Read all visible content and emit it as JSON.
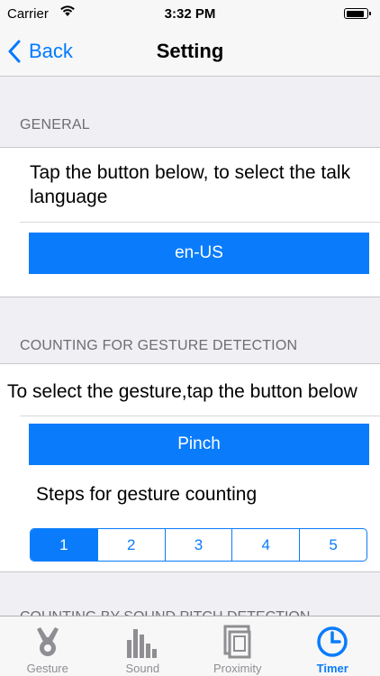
{
  "status_bar": {
    "carrier": "Carrier",
    "time": "3:32 PM"
  },
  "nav": {
    "back_label": "Back",
    "title": "Setting"
  },
  "general": {
    "header": "GENERAL",
    "description": "Tap the button below, to select the talk language",
    "description_line1": "Tap the button below, to select the talk",
    "description_line2": "language",
    "language_button": "en-US"
  },
  "gesture": {
    "header": "COUNTING FOR GESTURE DETECTION",
    "description": "To select the gesture,tap the button below",
    "gesture_button": "Pinch",
    "steps_label": "Steps for gesture counting",
    "steps": [
      "1",
      "2",
      "3",
      "4",
      "5"
    ],
    "selected_step": "1"
  },
  "next_section_header_partial": "COUNTING BY SOUND PITCH DETECTION",
  "tab_bar": {
    "tabs": [
      {
        "label": "Gesture",
        "icon": "gesture-icon",
        "active": false
      },
      {
        "label": "Sound",
        "icon": "sound-bars-icon",
        "active": false
      },
      {
        "label": "Proximity",
        "icon": "proximity-icon",
        "active": false
      },
      {
        "label": "Timer",
        "icon": "timer-clock-icon",
        "active": true
      }
    ]
  },
  "colors": {
    "accent": "#0a7cfb",
    "background": "#efeff4",
    "header_text": "#6d6d72"
  }
}
